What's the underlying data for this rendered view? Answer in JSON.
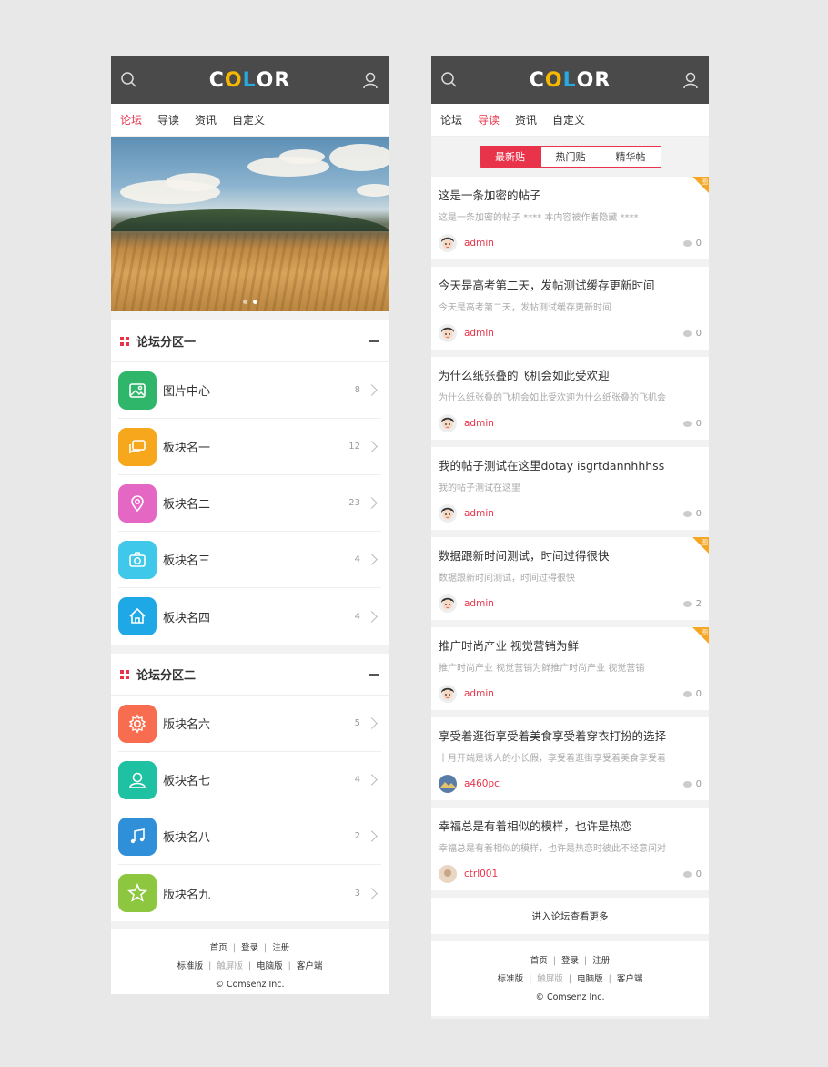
{
  "logo": {
    "letters": [
      {
        "ch": "C",
        "color": "#ffffff"
      },
      {
        "ch": "O",
        "color": "#f5b700"
      },
      {
        "ch": "L",
        "color": "#2aa8e0"
      },
      {
        "ch": "O",
        "color": "#ffffff"
      },
      {
        "ch": "R",
        "color": "#ffffff"
      }
    ]
  },
  "left": {
    "nav": [
      "论坛",
      "导读",
      "资讯",
      "自定义"
    ],
    "active_nav": 0,
    "banner_dots": 2,
    "sections": [
      {
        "title": "论坛分区一",
        "forums": [
          {
            "name": "图片中心",
            "count": "8",
            "icon": "image-icon",
            "color": "#2fb66b"
          },
          {
            "name": "板块名一",
            "count": "12",
            "icon": "chat-bubble-icon",
            "color": "#f7a71b"
          },
          {
            "name": "板块名二",
            "count": "23",
            "icon": "location-pin-icon",
            "color": "#e567c4"
          },
          {
            "name": "板块名三",
            "count": "4",
            "icon": "camera-icon",
            "color": "#3fc8ea"
          },
          {
            "name": "板块名四",
            "count": "4",
            "icon": "home-icon",
            "color": "#1fa8e6"
          }
        ]
      },
      {
        "title": "论坛分区二",
        "forums": [
          {
            "name": "版块名六",
            "count": "5",
            "icon": "gear-icon",
            "color": "#f86d4f"
          },
          {
            "name": "板块名七",
            "count": "4",
            "icon": "user-icon",
            "color": "#1ec2a2"
          },
          {
            "name": "板块名八",
            "count": "2",
            "icon": "music-icon",
            "color": "#2f8fd8"
          },
          {
            "name": "版块名九",
            "count": "3",
            "icon": "star-icon",
            "color": "#8dc63f"
          }
        ]
      }
    ],
    "footer": {
      "links1": [
        "首页",
        "登录",
        "注册"
      ],
      "links2": [
        "标准版",
        "触屏版",
        "电脑版",
        "客户端"
      ],
      "copyright": "© Comsenz Inc."
    }
  },
  "right": {
    "nav": [
      "论坛",
      "导读",
      "资讯",
      "自定义"
    ],
    "active_nav": 1,
    "segments": [
      "最新贴",
      "热门贴",
      "精华帖"
    ],
    "active_segment": 0,
    "posts": [
      {
        "title": "这是一条加密的帖子",
        "excerpt": "这是一条加密的帖子 **** 本内容被作者隐藏 ****",
        "author": "admin",
        "replies": "0",
        "image_tag": true,
        "avatar": "face"
      },
      {
        "title": "今天是高考第二天，发帖测试缓存更新时间",
        "excerpt": "今天是高考第二天，发帖测试缓存更新时间",
        "author": "admin",
        "replies": "0",
        "image_tag": false,
        "avatar": "face"
      },
      {
        "title": "为什么纸张叠的飞机会如此受欢迎",
        "excerpt": "为什么纸张叠的飞机会如此受欢迎为什么纸张叠的飞机会",
        "author": "admin",
        "replies": "0",
        "image_tag": false,
        "avatar": "face"
      },
      {
        "title": "我的帖子测试在这里dotay isgrtdannhhhss",
        "excerpt": "我的帖子测试在这里",
        "author": "admin",
        "replies": "0",
        "image_tag": false,
        "avatar": "face"
      },
      {
        "title": "数据跟新时间测试，时间过得很快",
        "excerpt": "数据跟新时间测试，时间过得很快",
        "author": "admin",
        "replies": "2",
        "image_tag": true,
        "avatar": "face"
      },
      {
        "title": "推广时尚产业 视觉营销为鲜",
        "excerpt": "推广时尚产业 视觉营销为鲜推广时尚产业 视觉营销",
        "author": "admin",
        "replies": "0",
        "image_tag": true,
        "avatar": "face"
      },
      {
        "title": "享受着逛街享受着美食享受着穿衣打扮的选择",
        "excerpt": "十月开端是诱人的小长假，享受着逛街享受着美食享受着",
        "author": "a460pc",
        "replies": "0",
        "image_tag": false,
        "avatar": "photo"
      },
      {
        "title": "幸福总是有着相似的模样，也许是热恋",
        "excerpt": "幸福总是有着相似的模样，也许是热恋时彼此不经意间对",
        "author": "ctrl001",
        "replies": "0",
        "image_tag": false,
        "avatar": "photo2"
      }
    ],
    "more": "进入论坛查看更多",
    "image_tag_label": "图",
    "footer": {
      "links1": [
        "首页",
        "登录",
        "注册"
      ],
      "links2": [
        "标准版",
        "触屏版",
        "电脑版",
        "客户端"
      ],
      "copyright": "© Comsenz Inc."
    }
  }
}
